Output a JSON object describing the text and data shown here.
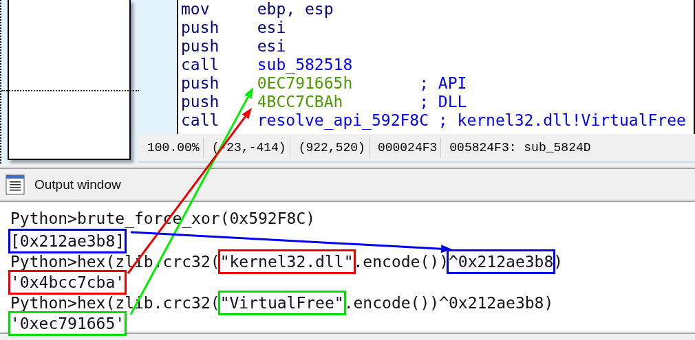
{
  "disassembly": {
    "lines": [
      {
        "mnemonic": "mov",
        "operand": {
          "text": "ebp, esp",
          "kind": "reg"
        }
      },
      {
        "mnemonic": "push",
        "operand": {
          "text": "esi",
          "kind": "reg"
        }
      },
      {
        "mnemonic": "push",
        "operand": {
          "text": "esi",
          "kind": "reg"
        }
      },
      {
        "mnemonic": "call",
        "operand": {
          "text": "sub_582518",
          "kind": "name"
        }
      },
      {
        "mnemonic": "push",
        "operand": {
          "text": "0EC791665h",
          "kind": "num"
        },
        "comment": "; API"
      },
      {
        "mnemonic": "push",
        "operand": {
          "text": "4BCC7CBAh",
          "kind": "num"
        },
        "comment": "; DLL"
      },
      {
        "mnemonic": "call",
        "operand": {
          "text": "resolve_api_592F8C",
          "kind": "name"
        },
        "comment": "; kernel32.dll!VirtualFree"
      }
    ]
  },
  "status_bar": [
    "100.00%",
    "(-23,-414)",
    "(922,520)",
    "000024F3",
    "005824F3: sub_5824D"
  ],
  "output_window": {
    "title": "Output window",
    "lines": [
      [
        {
          "text": "Python>brute_force_xor(0x592F8C)"
        }
      ],
      [
        {
          "text": "[0x212ae3b8]",
          "color": "#0000ee"
        }
      ],
      [
        {
          "text": "Python>hex(zlib.crc32("
        },
        {
          "text": "\"kernel32.dll\"",
          "color": "#ee0000"
        },
        {
          "text": ".encode())"
        },
        {
          "text": "^0x212ae3b8",
          "color": "#0000ee"
        },
        {
          "text": ")"
        }
      ],
      [
        {
          "text": "'0x4bcc7cba'",
          "color": "#ee0000"
        }
      ],
      [
        {
          "text": "Python>hex(zlib.crc32("
        },
        {
          "text": "\"VirtualFree\"",
          "color": "#00dd00"
        },
        {
          "text": ".encode())^0x212ae3b8)"
        }
      ],
      [
        {
          "text": "'0xec791665'",
          "color": "#00dd00"
        }
      ]
    ]
  },
  "arrows": [
    {
      "color": "#00ee00"
    },
    {
      "color": "#ee0000"
    },
    {
      "color": "#0000ee"
    }
  ]
}
